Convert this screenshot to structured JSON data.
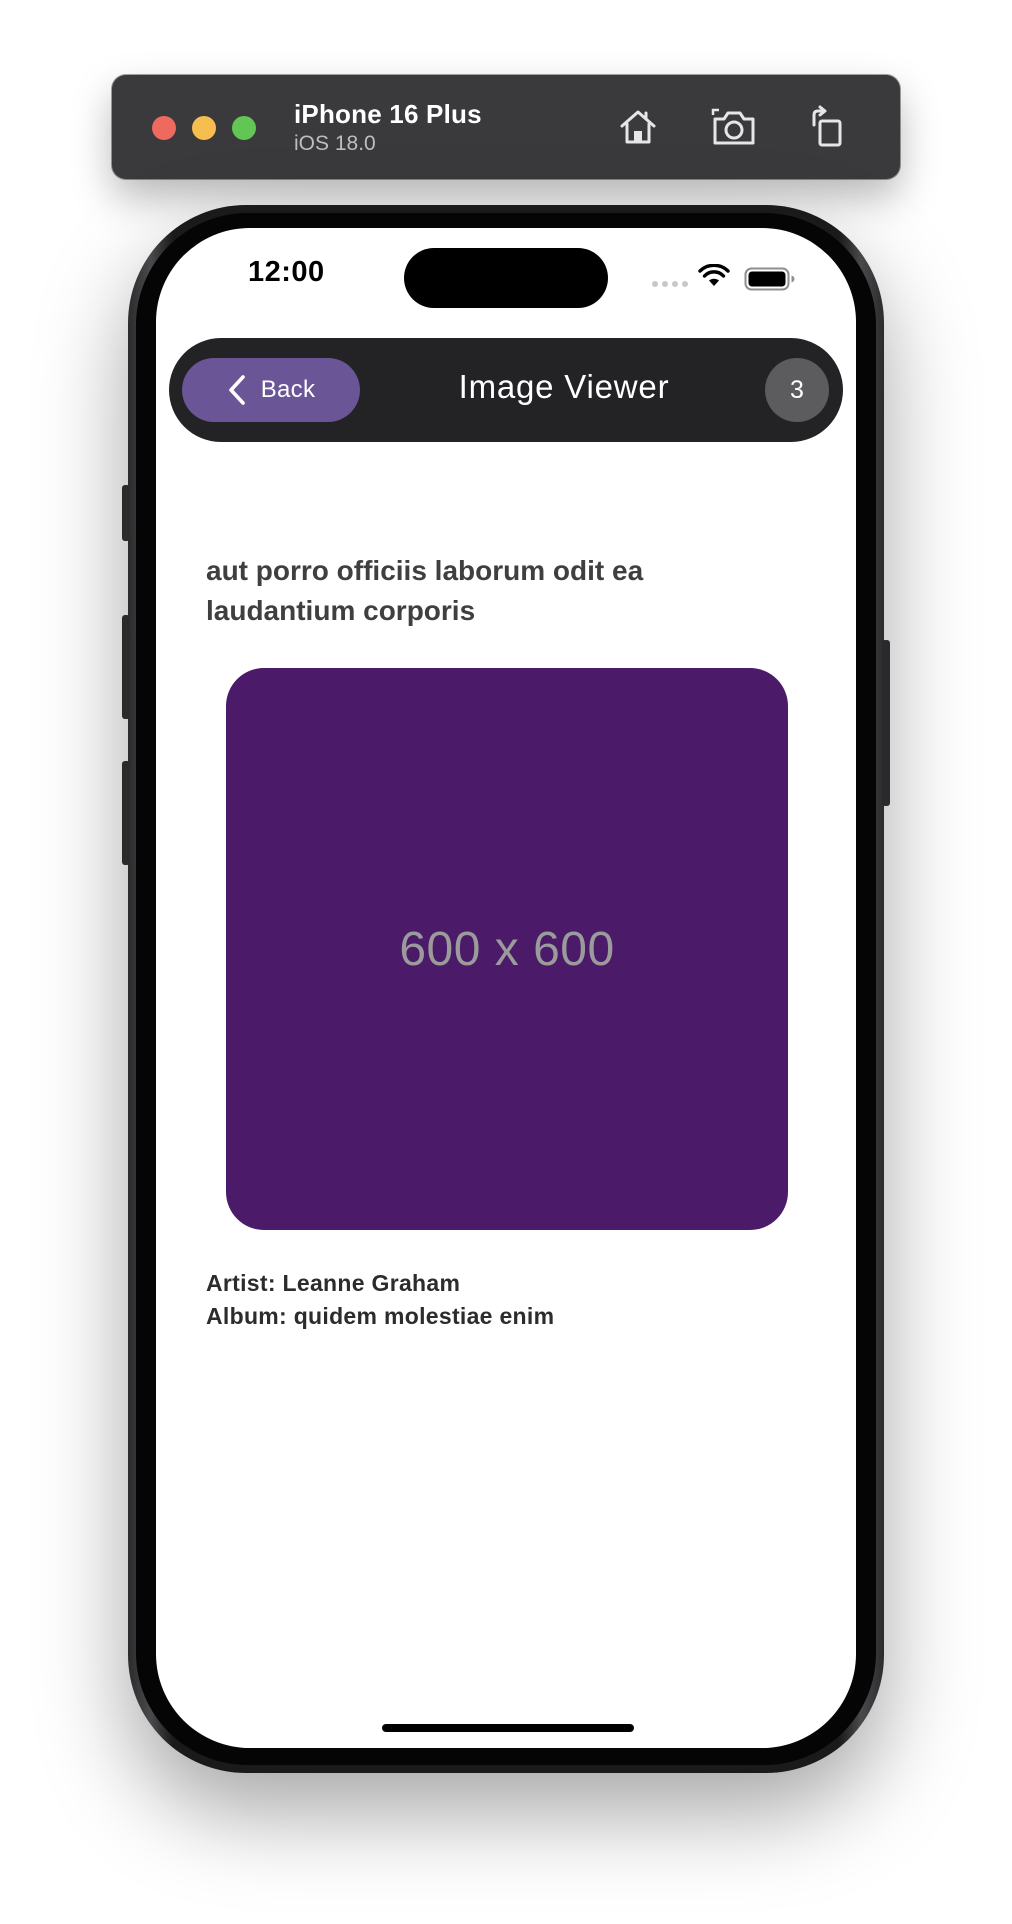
{
  "simulator": {
    "device_name": "iPhone 16 Plus",
    "os_version": "iOS 18.0",
    "controls": [
      {
        "name": "home-icon"
      },
      {
        "name": "screenshot-icon"
      },
      {
        "name": "rotate-icon"
      }
    ]
  },
  "status_bar": {
    "time": "12:00"
  },
  "navbar": {
    "back_label": "Back",
    "title": "Image Viewer",
    "badge_count": "3"
  },
  "photo": {
    "title": "aut porro officiis laborum odit ea laudantium corporis",
    "placeholder_text": "600 x 600",
    "placeholder_color": "#4b1b6a",
    "artist_line": "Artist: Leanne Graham",
    "album_line": "Album: quidem molestiae enim"
  },
  "colors": {
    "back_button": "#6a5596",
    "navbar": "#232224",
    "badge": "#5c5b5e"
  }
}
